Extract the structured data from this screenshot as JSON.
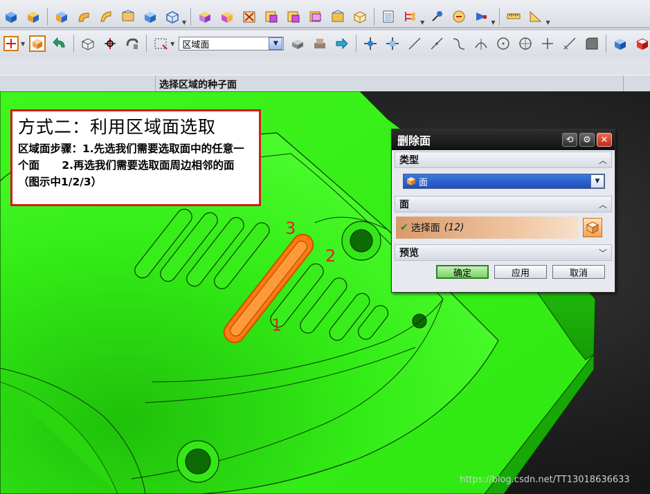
{
  "toolbar": {
    "row1_icons": [
      "shaded-block-icon",
      "shaded-block-icon",
      "shaded-block-icon",
      "blend-icon",
      "blend-icon",
      "sheet-icon",
      "cube-icon",
      "wire-cube-icon",
      "move-face-icon",
      "offset-face-icon",
      "delete-face-icon",
      "replace-face-icon",
      "replace-face-icon",
      "replace-face-icon",
      "edge-face-icon",
      "wire-cube-icon",
      "layer-icon",
      "tree-icon",
      "pin-icon",
      "measure-icon",
      "ruler-icon",
      "protractor-icon"
    ],
    "row2_icons": [
      "snap-point-icon",
      "view-cube-icon",
      "undo-arrow-icon",
      "rotate-view-icon",
      "orient-view-icon",
      "pan-view-icon",
      "rectangle-select-icon"
    ],
    "selection_filter": "区域面",
    "row2_right_icons": [
      "shaded-block-icon",
      "shaded-block-icon",
      "forward-arrow-icon",
      "move-handle-icon",
      "move-handle-icon",
      "line-icon",
      "line-icon",
      "curve-icon",
      "arc-icon",
      "circle-icon",
      "circle-icon",
      "point-plus-icon",
      "line-icon",
      "blend-icon",
      "cube-icon",
      "red-cube-icon"
    ]
  },
  "cue_line": {
    "message": "选择区域的种子面"
  },
  "annotation": {
    "heading": "方式二：利用区域面选取",
    "body": "区域面步骤：1.先选我们需要选取面中的任意一个面      2.再选我们需要选取面周边相邻的面（图示中1/2/3）"
  },
  "viewport_marks": [
    "1",
    "2",
    "3"
  ],
  "dialog": {
    "title": "删除面",
    "title_buttons": [
      "reset-icon",
      "gear-icon",
      "close-icon"
    ],
    "group_type": "类型",
    "type_value": "面",
    "group_face": "面",
    "select_face_label": "选择面",
    "select_face_count": "(12)",
    "group_preview": "预览",
    "buttons": {
      "ok": "确定",
      "apply": "应用",
      "cancel": "取消"
    }
  },
  "watermark": "https://blog.csdn.net/TT13018636633",
  "colors": {
    "model_green": "#35f516",
    "highlight_orange": "#ff7a10",
    "annotation_red": "#d4191f"
  }
}
